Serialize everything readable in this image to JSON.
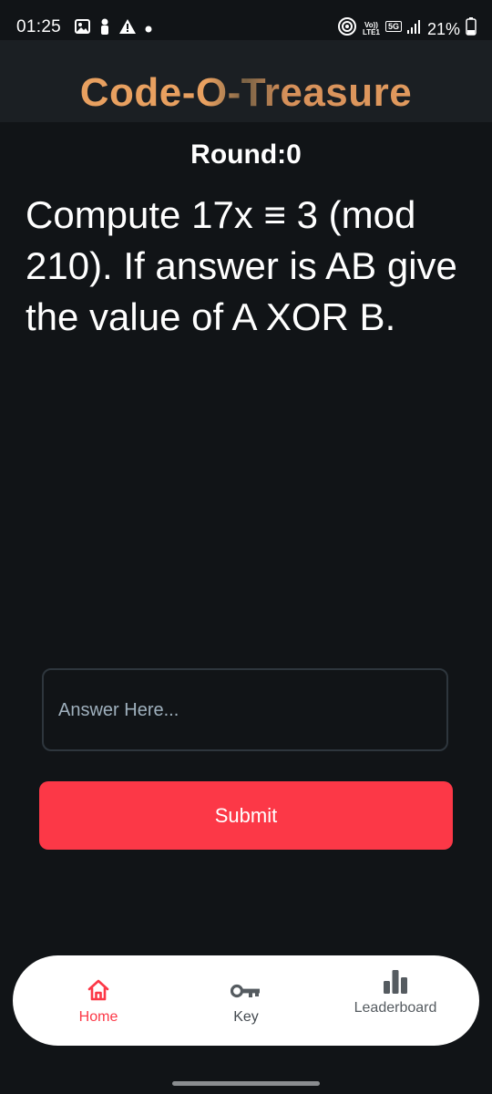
{
  "status_bar": {
    "time": "01:25",
    "volte_top": "Vo))",
    "volte_bottom": "LTE1",
    "network": "5G",
    "battery": "21%",
    "icons": [
      "gallery-icon",
      "person-icon",
      "warning-icon",
      "dot-icon",
      "hotspot-icon",
      "signal-icon",
      "battery-icon"
    ]
  },
  "header": {
    "title": "Code-O-Treasure"
  },
  "round": {
    "label": "Round:0"
  },
  "question": {
    "text": "Compute 17x ≡ 3 (mod 210). If answer is AB give the value of A XOR B."
  },
  "answer": {
    "placeholder": "Answer Here...",
    "value": ""
  },
  "submit": {
    "label": "Submit"
  },
  "bottom_nav": {
    "items": [
      {
        "label": "Home",
        "icon": "home-icon",
        "active": true
      },
      {
        "label": "Key",
        "icon": "key-icon",
        "active": false
      },
      {
        "label": "Leaderboard",
        "icon": "leaderboard-icon",
        "active": false
      }
    ]
  },
  "colors": {
    "background": "#111417",
    "header_bg": "#1b1f23",
    "title_accent": "#e8a060",
    "submit_bg": "#fc3847",
    "active_nav": "#fc3847"
  }
}
